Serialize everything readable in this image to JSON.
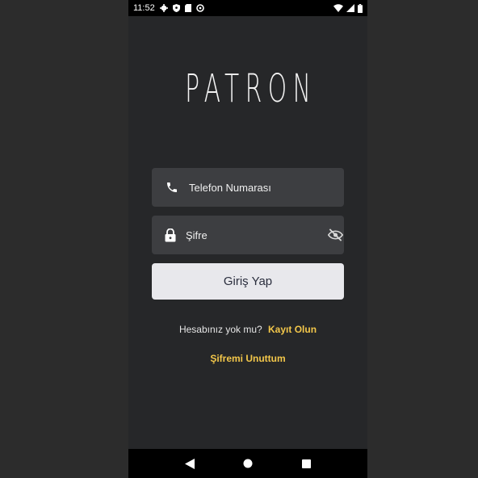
{
  "status_bar": {
    "time": "11:52",
    "icons": [
      "gear-icon",
      "shield-icon",
      "sim-card-icon",
      "circle-status-icon"
    ],
    "right_icons": [
      "wifi-icon",
      "signal-icon",
      "battery-icon"
    ]
  },
  "logo": {
    "text": "PATRON"
  },
  "form": {
    "phone": {
      "placeholder": "Telefon Numarası",
      "value": "",
      "icon": "phone-icon"
    },
    "password": {
      "placeholder": "Şifre",
      "value": "",
      "icon": "lock-icon",
      "toggle_icon": "eye-off-icon"
    },
    "login_button": "Giriş Yap"
  },
  "register": {
    "prompt": "Hesabınız yok mu?",
    "link": "Kayıt Olun"
  },
  "forgot_password": "Şifremi Unuttum",
  "nav": {
    "buttons": [
      "back-icon",
      "home-icon",
      "recents-icon"
    ]
  },
  "colors": {
    "background": "#262729",
    "field": "#3d3e41",
    "button": "#e8e8ec",
    "accent": "#f3c74a"
  }
}
